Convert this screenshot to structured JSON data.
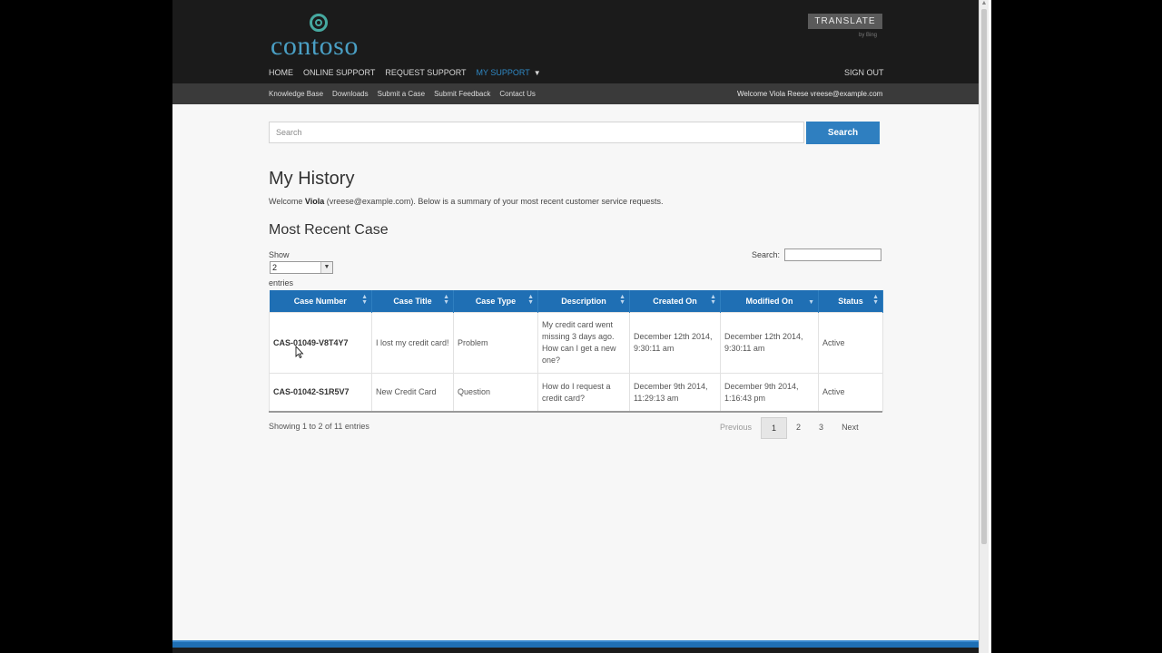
{
  "header": {
    "logo_text": "contoso",
    "translate_label": "TRANSLATE",
    "powered_text": "by Bing",
    "nav": [
      {
        "label": "HOME",
        "active": false
      },
      {
        "label": "ONLINE SUPPORT",
        "active": false
      },
      {
        "label": "REQUEST SUPPORT",
        "active": false
      },
      {
        "label": "MY SUPPORT",
        "active": true
      }
    ],
    "signout_label": "SIGN OUT",
    "subnav": [
      "Knowledge Base",
      "Downloads",
      "Submit a Case",
      "Submit Feedback",
      "Contact Us"
    ],
    "welcome": "Welcome Viola Reese  vreese@example.com"
  },
  "search": {
    "placeholder": "Search",
    "button_label": "Search"
  },
  "page": {
    "title": "My History",
    "intro_prefix": "Welcome ",
    "intro_name": "Viola",
    "intro_rest": " (vreese@example.com). Below is a summary of your most recent customer service requests.",
    "section_title": "Most Recent Case"
  },
  "table_controls": {
    "show_label": "Show",
    "length_value": "2",
    "entries_label": "entries",
    "filter_label": "Search:"
  },
  "table": {
    "columns": [
      "Case Number",
      "Case Title",
      "Case Type",
      "Description",
      "Created On",
      "Modified On",
      "Status"
    ],
    "rows": [
      [
        "CAS-01049-V8T4Y7",
        "I lost my credit card!",
        "Problem",
        "My credit card went missing 3 days ago. How can I get a new one?",
        "December 12th 2014, 9:30:11 am",
        "December 12th 2014, 9:30:11 am",
        "Active"
      ],
      [
        "CAS-01042-S1R5V7",
        "New Credit Card",
        "Question",
        "How do I request a credit card?",
        "December 9th 2014, 11:29:13 am",
        "December 9th 2014, 1:16:43 pm",
        "Active"
      ]
    ]
  },
  "pagination": {
    "info": "Showing 1 to 2 of 11 entries",
    "previous": "Previous",
    "pages": [
      "1",
      "2",
      "3"
    ],
    "next": "Next",
    "current": "1"
  },
  "colors": {
    "accent": "#1f6fb4",
    "header_bg": "#1b1b1b",
    "subnav_bg": "#3a3a3a",
    "active_nav": "#2f88c4"
  }
}
